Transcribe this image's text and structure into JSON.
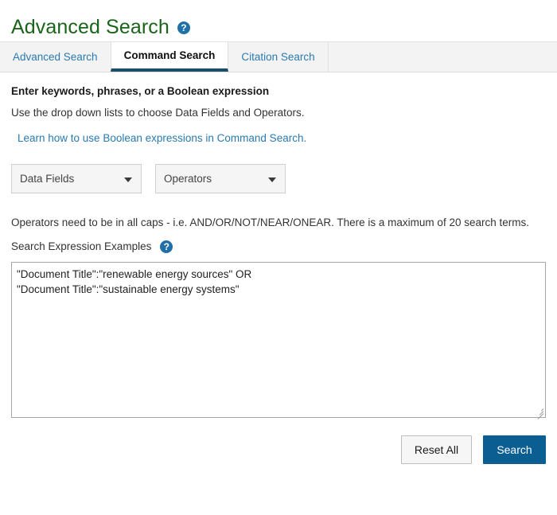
{
  "header": {
    "title": "Advanced Search",
    "help_icon_glyph": "?",
    "help_icon_name": "help-circle-icon",
    "title_color": "#1a6419"
  },
  "tabs": [
    {
      "label": "Advanced Search",
      "active": false
    },
    {
      "label": "Command Search",
      "active": true
    },
    {
      "label": "Citation Search",
      "active": false
    }
  ],
  "instructions": {
    "heading": "Enter keywords, phrases, or a Boolean expression",
    "subtext": "Use the drop down lists to choose Data Fields and Operators.",
    "learn_link": "Learn how to use Boolean expressions in Command Search."
  },
  "selects": {
    "data_fields": {
      "label": "Data Fields",
      "caret": "chevron-down"
    },
    "operators": {
      "label": "Operators",
      "caret": "chevron-down"
    }
  },
  "notes": {
    "operators_note": "Operators need to be in all caps - i.e. AND/OR/NOT/NEAR/ONEAR. There is a maximum of 20 search terms.",
    "examples_label": "Search Expression Examples",
    "examples_help_glyph": "?"
  },
  "query": {
    "value": "\"Document Title\":\"renewable energy sources\" OR\n\"Document Title\":\"sustainable energy systems\"",
    "placeholder": ""
  },
  "buttons": {
    "reset": "Reset All",
    "search": "Search"
  },
  "colors": {
    "title_green": "#1a6419",
    "link_blue": "#2a7ab0",
    "primary_blue": "#0b5e92",
    "active_tab_underline": "#1b4e6b",
    "help_icon_blue": "#1f6fa8",
    "tabbar_bg": "#f3f3f3"
  }
}
